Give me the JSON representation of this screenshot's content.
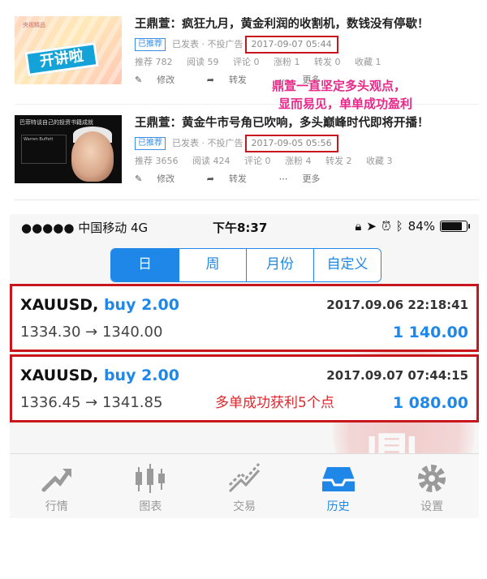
{
  "articles": [
    {
      "thumb_sign": "开讲啦",
      "thumb_tag": "央视精品",
      "title": "王鼎萱：疯狂九月，黄金利润的收割机，数钱没有停歇！",
      "badge": "已推荐",
      "status": "已发表 · 不投广告",
      "date": "2017-09-07 05:44",
      "stats": {
        "recommend": "推荐 782",
        "reads": "阅读 59",
        "comments": "评论 0",
        "likes": "涨粉 1",
        "shares": "转发 0",
        "favorites": "收藏 1"
      },
      "actions": {
        "edit": "修改",
        "forward": "转发",
        "more": "更多"
      }
    },
    {
      "thumb_caption": "巴菲特谈自己的投资书籍成就",
      "thumb_quote": "Warren Buffett",
      "title": "王鼎萱：黄金牛市号角已吹响，多头巅峰时代即将开播！",
      "badge": "已推荐",
      "status": "已发表 · 不投广告",
      "date": "2017-09-05 05:56",
      "stats": {
        "recommend": "推荐 3656",
        "reads": "阅读 424",
        "comments": "评论 0",
        "likes": "涨粉 4",
        "shares": "转发 2",
        "favorites": "收藏 3"
      },
      "actions": {
        "edit": "修改",
        "forward": "转发",
        "more": "更多"
      }
    }
  ],
  "annotation_top": {
    "line1": "鼎萱一直坚定多头观点，",
    "line2": "显而易见，单单成功盈利"
  },
  "phone": {
    "status": {
      "signal": "●●●●● 中国移动  4G",
      "time": "下午8:37",
      "battery_text": "84%",
      "battery_level": 0.84
    },
    "segments": [
      {
        "label": "日",
        "active": true
      },
      {
        "label": "周",
        "active": false
      },
      {
        "label": "月份",
        "active": false
      },
      {
        "label": "自定义",
        "active": false
      }
    ],
    "trades": [
      {
        "symbol": "XAUUSD,",
        "direction": "buy 2.00",
        "time": "2017.09.06 22:18:41",
        "prices": "1334.30 → 1340.00",
        "profit": "1 140.00"
      },
      {
        "symbol": "XAUUSD,",
        "direction": "buy 2.00",
        "time": "2017.09.07 07:44:15",
        "prices": "1336.45 → 1341.85",
        "profit": "1 080.00",
        "annotation": "多单成功获利5个点"
      }
    ],
    "watermark": "鼎萱",
    "tabs": [
      {
        "label": "行情",
        "icon": "trend-arrow-icon"
      },
      {
        "label": "图表",
        "icon": "candlestick-icon"
      },
      {
        "label": "交易",
        "icon": "trade-line-icon"
      },
      {
        "label": "历史",
        "icon": "inbox-history-icon",
        "active": true
      },
      {
        "label": "设置",
        "icon": "gear-icon"
      }
    ]
  },
  "colors": {
    "accent_blue": "#1f87e8",
    "highlight_red": "#c8171c",
    "annotation_pink": "#e8298a",
    "annotation_red": "#e0262b"
  }
}
